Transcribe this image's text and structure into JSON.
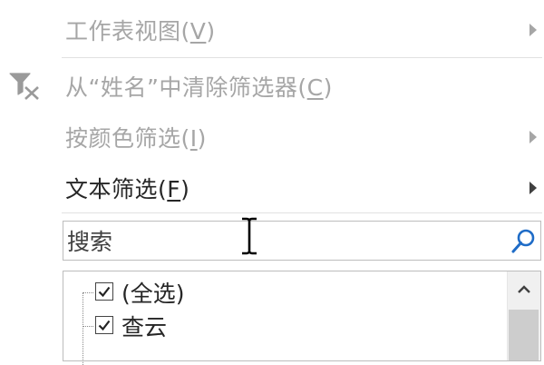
{
  "menu": {
    "sheet_view": {
      "label": "工作表视图",
      "accel": "V",
      "enabled": false,
      "has_submenu": true
    },
    "clear_filter": {
      "label": "从“姓名”中清除筛选器",
      "accel": "C",
      "enabled": false,
      "icon": "clear-filter-icon"
    },
    "filter_by_color": {
      "label": "按颜色筛选",
      "accel": "I",
      "enabled": false,
      "has_submenu": true
    },
    "text_filters": {
      "label": "文本筛选",
      "accel": "F",
      "enabled": true,
      "has_submenu": true
    }
  },
  "search": {
    "placeholder": "搜索",
    "icon": "search-icon"
  },
  "checklist": {
    "items": [
      {
        "label": "(全选)",
        "checked": true
      },
      {
        "label": "查云",
        "checked": true
      }
    ]
  },
  "colors": {
    "disabled_text": "#a6a6a6",
    "text": "#262626",
    "search_icon": "#1f6cc7"
  }
}
